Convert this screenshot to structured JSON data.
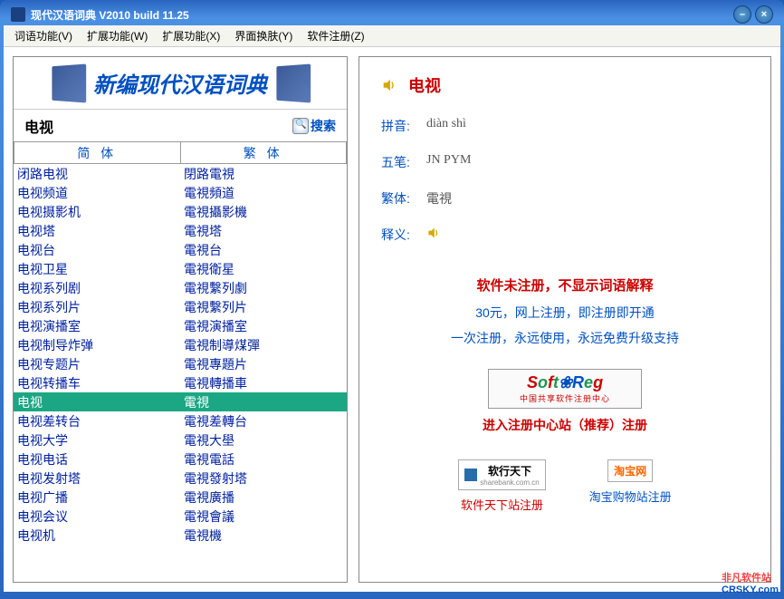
{
  "window": {
    "title": "现代汉语词典 V2010 build 11.25"
  },
  "menu": {
    "items": [
      "词语功能(V)",
      "扩展功能(W)",
      "扩展功能(X)",
      "界面换肤(Y)",
      "软件注册(Z)"
    ]
  },
  "banner": {
    "title": "新编现代汉语词典"
  },
  "search": {
    "value": "电视",
    "button": "搜索"
  },
  "columns": {
    "simplified": "简 体",
    "traditional": "繁 体"
  },
  "results": [
    {
      "s": "闭路电视",
      "t": "閉路電視",
      "sel": false
    },
    {
      "s": "电视频道",
      "t": "電視頻道",
      "sel": false
    },
    {
      "s": "电视摄影机",
      "t": "電視攝影機",
      "sel": false
    },
    {
      "s": "电视塔",
      "t": "電視塔",
      "sel": false
    },
    {
      "s": "电视台",
      "t": "電視台",
      "sel": false
    },
    {
      "s": "电视卫星",
      "t": "電視衛星",
      "sel": false
    },
    {
      "s": "电视系列剧",
      "t": "電視繫列劇",
      "sel": false
    },
    {
      "s": "电视系列片",
      "t": "電視繫列片",
      "sel": false
    },
    {
      "s": "电视演播室",
      "t": "電視演播室",
      "sel": false
    },
    {
      "s": "电视制导炸弹",
      "t": "電視制導煤彈",
      "sel": false
    },
    {
      "s": "电视专题片",
      "t": "電視專題片",
      "sel": false
    },
    {
      "s": "电视转播车",
      "t": "電視轉播車",
      "sel": false
    },
    {
      "s": "电视",
      "t": "電視",
      "sel": true
    },
    {
      "s": "电视差转台",
      "t": "電視差轉台",
      "sel": false
    },
    {
      "s": "电视大学",
      "t": "電視大壆",
      "sel": false
    },
    {
      "s": "电视电话",
      "t": "電視電話",
      "sel": false
    },
    {
      "s": "电视发射塔",
      "t": "電視發射塔",
      "sel": false
    },
    {
      "s": "电视广播",
      "t": "電視廣播",
      "sel": false
    },
    {
      "s": "电视会议",
      "t": "電視會議",
      "sel": false
    },
    {
      "s": "电视机",
      "t": "電視機",
      "sel": false
    }
  ],
  "entry": {
    "word": "电视",
    "pinyin_label": "拼音:",
    "pinyin": "diàn shì",
    "wubi_label": "五笔:",
    "wubi": "JN  PYM",
    "fanti_label": "繁体:",
    "fanti": "電視",
    "shiyi_label": "释义:"
  },
  "notice": {
    "headline": "软件未注册，不显示词语解释",
    "line1": "30元，网上注册，即注册即开通",
    "line2": "一次注册，永远使用，永远免费升级支持"
  },
  "softreg": {
    "sub": "中国共享软件注册中心",
    "main_link": "进入注册中心站（推荐）注册"
  },
  "bottom": {
    "left_badge_text": "软行天下",
    "left_badge_sub": "sharebank.com.cn",
    "left_link": "软件天下站注册",
    "right_badge_text": "淘宝网",
    "right_link": "淘宝购物站注册"
  },
  "watermark": {
    "top": "非凡软件站",
    "bot": "CRSKY.com"
  }
}
